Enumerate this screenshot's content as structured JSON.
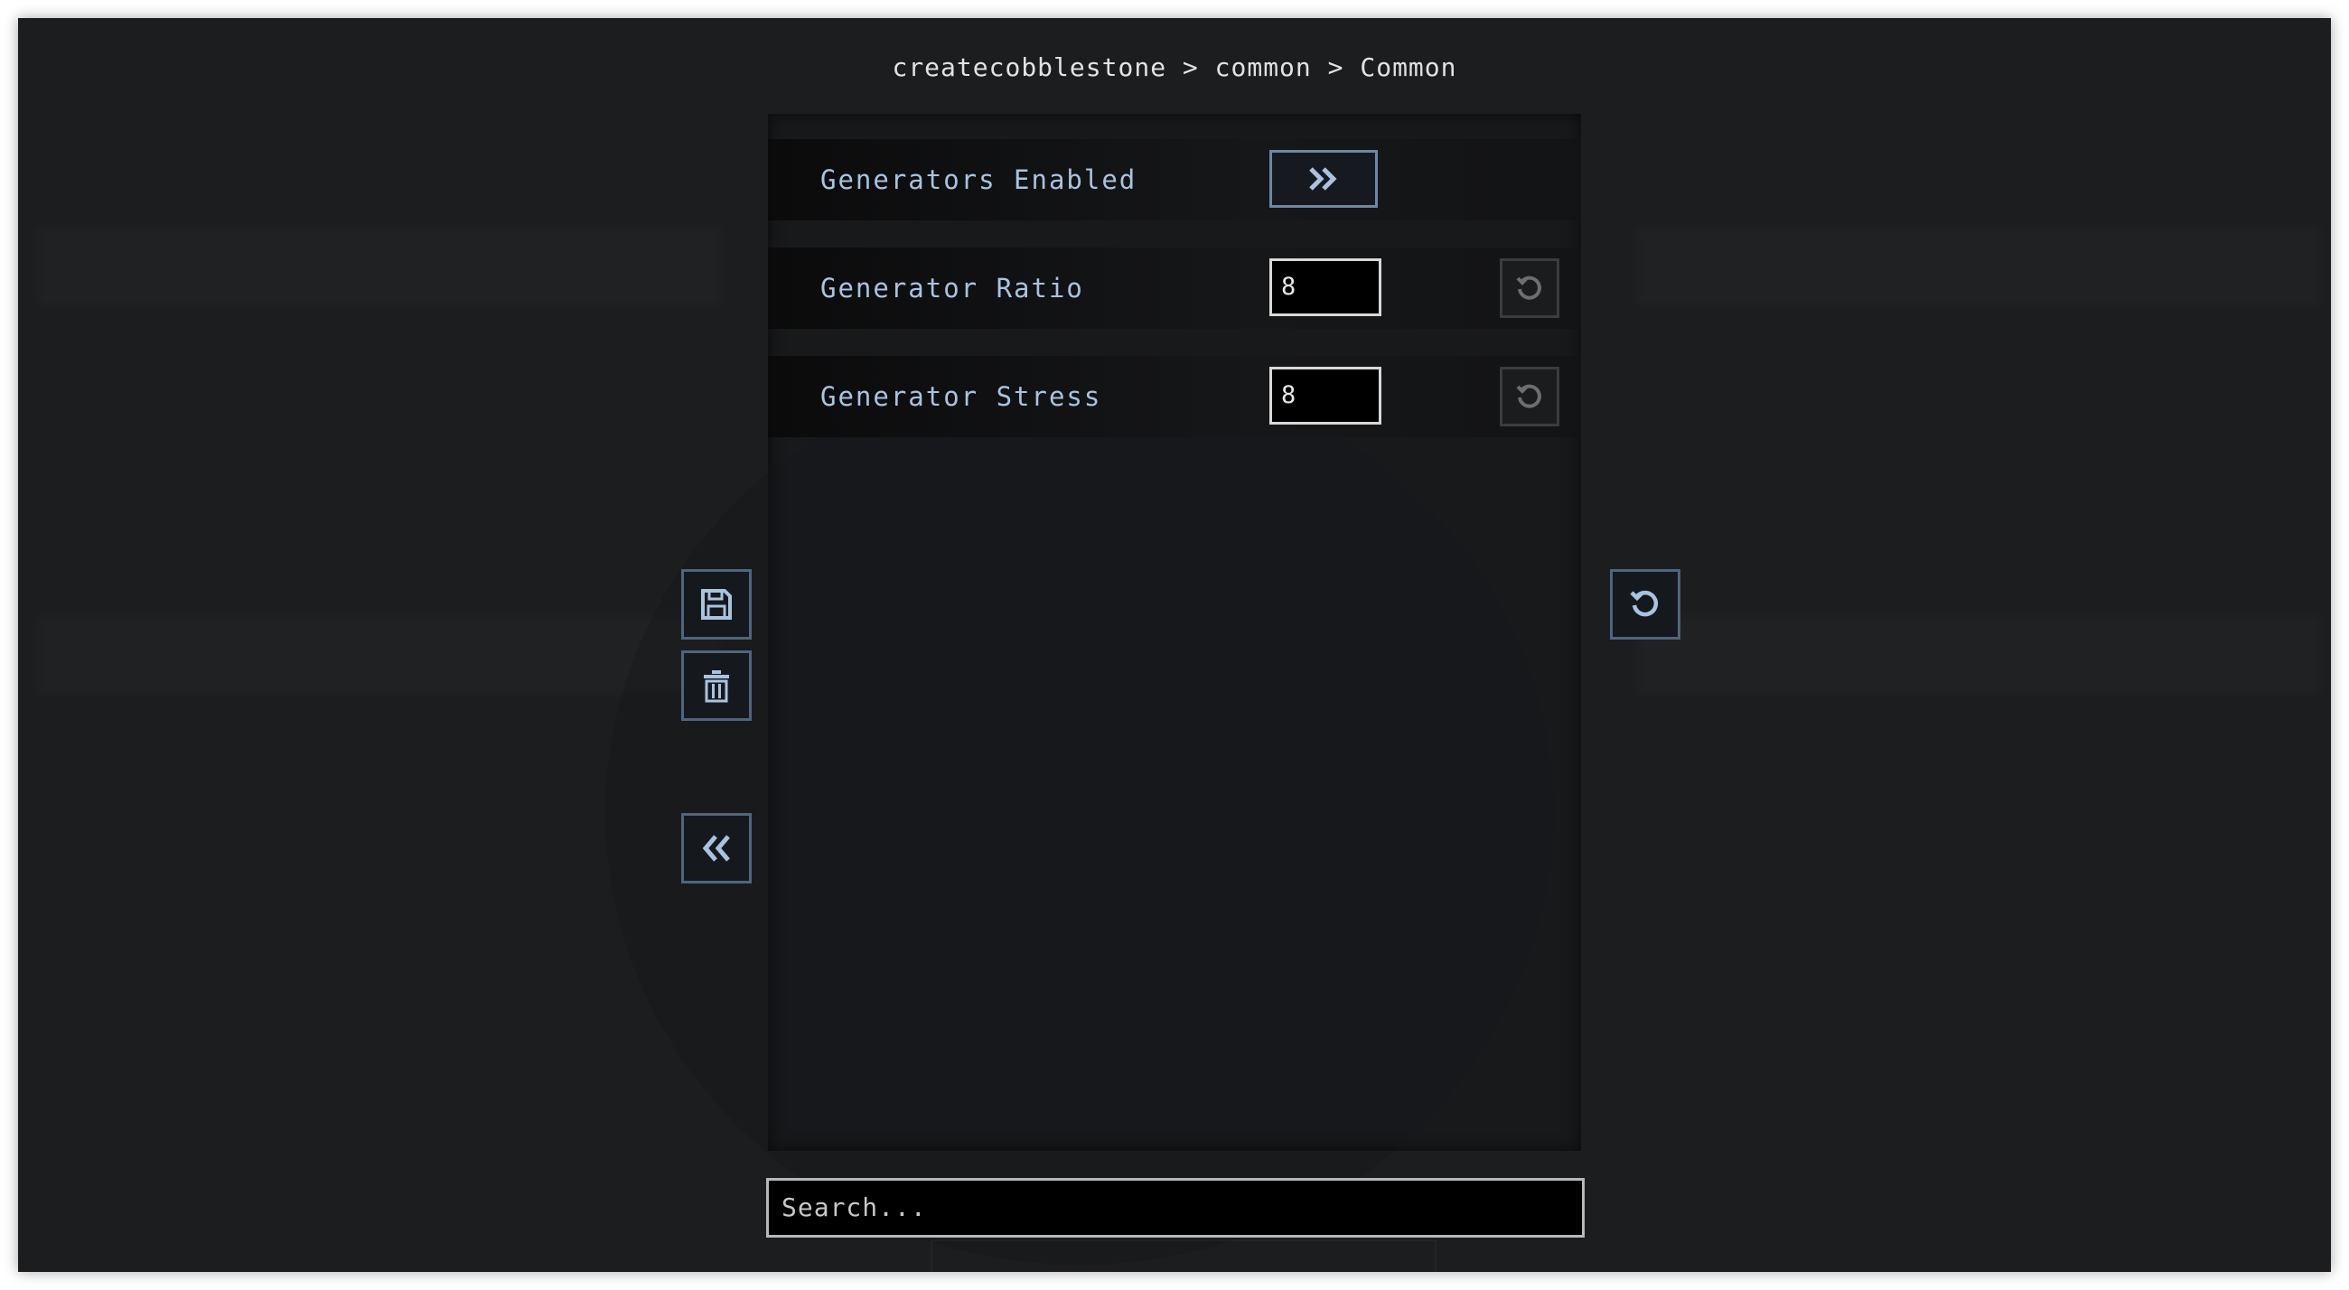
{
  "breadcrumb": {
    "mod": "createcobblestone",
    "sep1": ">",
    "type": "common",
    "sep2": ">",
    "section": "Common"
  },
  "settings": [
    {
      "label": "Generators Enabled",
      "control": "toggle",
      "icon": "double-chevron-right-icon"
    },
    {
      "label": "Generator Ratio",
      "control": "number",
      "value": "8",
      "reset_icon": "reset-icon"
    },
    {
      "label": "Generator Stress",
      "control": "number",
      "value": "8",
      "reset_icon": "reset-icon"
    }
  ],
  "sidebar_left": {
    "save_icon": "save-icon",
    "discard_icon": "trash-icon",
    "back_icon": "double-chevron-left-icon"
  },
  "sidebar_right": {
    "reset_all_icon": "reset-icon"
  },
  "search": {
    "placeholder": "Search..."
  },
  "colors": {
    "background": "#1c1d1f",
    "label": "#a9c3df",
    "accent_border": "#4e6580",
    "input_border": "#d8d8d8"
  }
}
